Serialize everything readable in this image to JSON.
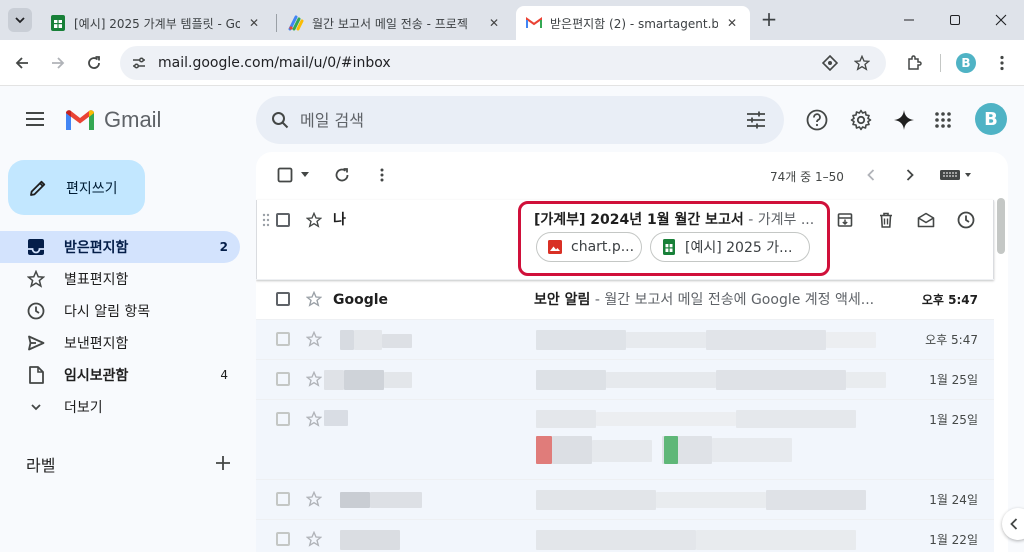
{
  "browser": {
    "tabs": [
      {
        "title": "[예시] 2025 가계부 템플릿 - Go",
        "favicon": "sheets-icon"
      },
      {
        "title": "월간 보고서 메일 전송 - 프로젝",
        "favicon": "apps-script-icon"
      },
      {
        "title": "받은편지함 (2) - smartagent.b",
        "favicon": "gmail-icon",
        "active": true
      }
    ],
    "new_tab": "+",
    "url": "mail.google.com/mail/u/0/#inbox",
    "profile_initial": "B"
  },
  "gmail": {
    "logo_text": "Gmail",
    "search_placeholder": "메일 검색",
    "avatar_initial": "B",
    "compose_label": "편지쓰기",
    "nav": [
      {
        "label": "받은편지함",
        "count": "2",
        "icon": "inbox-icon",
        "selected": true
      },
      {
        "label": "별표편지함",
        "count": "",
        "icon": "star-icon"
      },
      {
        "label": "다시 알림 항목",
        "count": "",
        "icon": "clock-icon"
      },
      {
        "label": "보낸편지함",
        "count": "",
        "icon": "send-icon"
      },
      {
        "label": "임시보관함",
        "count": "4",
        "icon": "draft-icon",
        "bold": true
      },
      {
        "label": "더보기",
        "count": "",
        "icon": "chevron-down-icon"
      }
    ],
    "labels_title": "라벨",
    "pager": "74개 중 1–50",
    "emails": [
      {
        "sender": "나",
        "subject": "[가계부] 2024년 1월 월간 보고서",
        "snippet": " - 가계부 ...",
        "attachments": [
          {
            "name": "chart.p...",
            "type": "image-icon"
          },
          {
            "name": "[예시] 2025 가...",
            "type": "sheets-icon"
          }
        ]
      },
      {
        "sender": "Google",
        "subject": "보안 알림",
        "snippet": " - 월간 보고서 메일 전송에 Google 계정 액세...",
        "date": "오후 5:47"
      },
      {
        "date": "오후 5:47"
      },
      {
        "date": "1월 25일"
      },
      {
        "date": "1월 25일"
      },
      {
        "date": "1월 24일"
      },
      {
        "date": "1월 22일"
      }
    ]
  },
  "colors": {
    "gmail_red": "#ea4335",
    "gmail_blue": "#4285f4",
    "gmail_green": "#34a853",
    "gmail_yellow": "#fbbc04",
    "selected_nav": "#d3e3fd",
    "compose_bg": "#c2e7ff",
    "highlight": "#d0103a",
    "avatar": "#4fb3c5"
  }
}
